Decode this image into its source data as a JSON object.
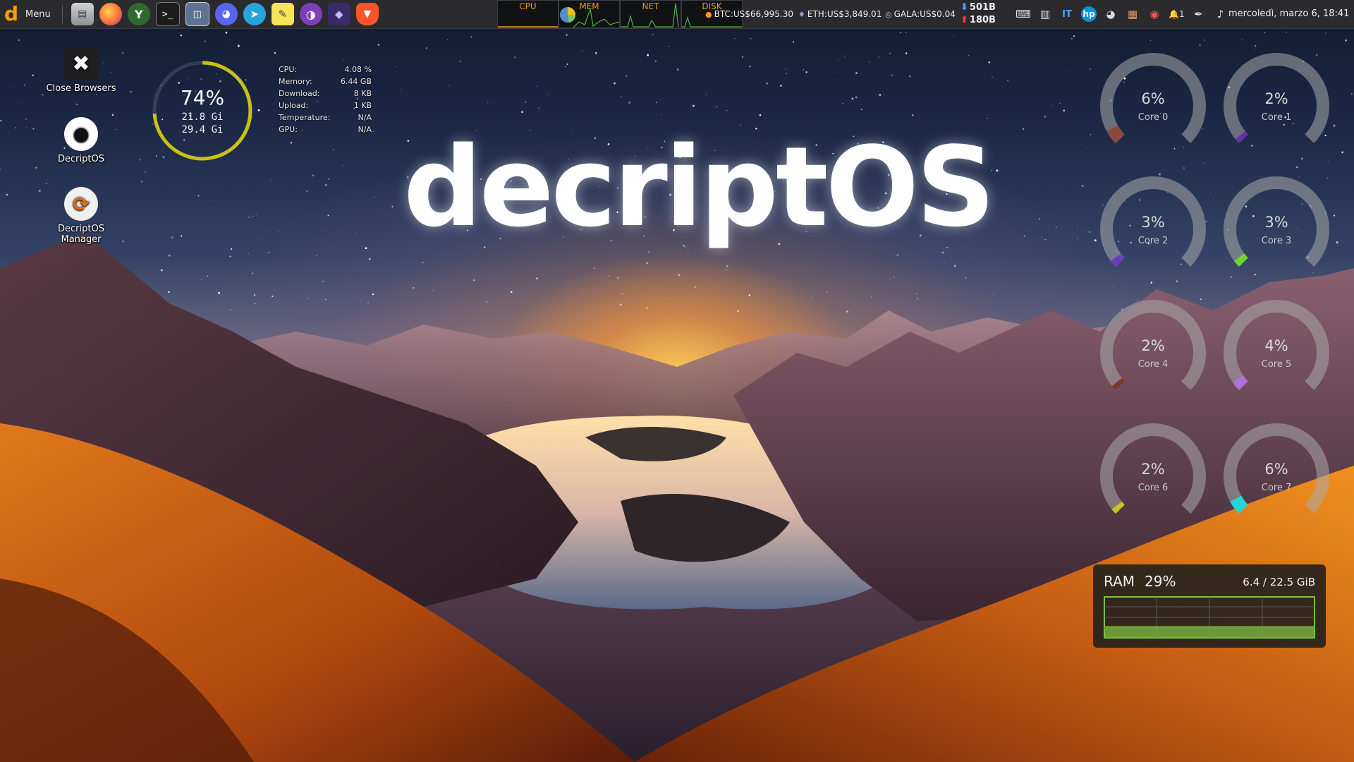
{
  "panel": {
    "menu_label": "Menu",
    "logo_letter": "d",
    "launchers": [
      {
        "name": "files-icon",
        "glyph": "▤"
      },
      {
        "name": "firefox-icon",
        "glyph": "●"
      },
      {
        "name": "vpn-icon",
        "glyph": "Y"
      },
      {
        "name": "terminal-icon",
        "glyph": ">_"
      },
      {
        "name": "screenshot-icon",
        "glyph": "◫"
      },
      {
        "name": "discord-icon",
        "glyph": "◕"
      },
      {
        "name": "telegram-icon",
        "glyph": "➤"
      },
      {
        "name": "notes-icon",
        "glyph": "✎"
      },
      {
        "name": "tor-icon",
        "glyph": "◑"
      },
      {
        "name": "proton-icon",
        "glyph": "◆"
      },
      {
        "name": "brave-icon",
        "glyph": "▼"
      }
    ],
    "monitors": {
      "cpu": "CPU",
      "mem": "MEM",
      "net": "NET",
      "disk": "DISK"
    },
    "crypto": {
      "btc": "BTC:US$66,995.30",
      "eth": "ETH:US$3,849.01",
      "gala": "GALA:US$0.04"
    },
    "net": {
      "down": "501B",
      "up": "180B"
    },
    "tray": {
      "lang": "IT",
      "hp": "hp",
      "notif_count": "1"
    },
    "clock": "mercoledì, marzo  6, 18:41"
  },
  "desktop_icons": [
    {
      "label": "Close Browsers",
      "glyph": "✖"
    },
    {
      "label": "DecriptOS",
      "glyph": "🐙"
    },
    {
      "label": "DecriptOS Manager",
      "glyph": "⟳"
    }
  ],
  "memory_widget": {
    "percent_text": "74%",
    "percent": 74,
    "used": "21.8 Gi",
    "total": "29.4 Gi",
    "ring_color": "#c9c11a"
  },
  "stats": [
    {
      "label": "CPU:",
      "value": "4.08 %"
    },
    {
      "label": "Memory:",
      "value": "6.44 GB"
    },
    {
      "label": "Download:",
      "value": "8 KB"
    },
    {
      "label": "Upload:",
      "value": "1 KB"
    },
    {
      "label": "Temperature:",
      "value": "N/A"
    },
    {
      "label": "GPU:",
      "value": "N/A"
    }
  ],
  "brand_text": "decriptOS",
  "cores": [
    {
      "label": "Core 0",
      "pct": "6%",
      "value": 6,
      "color": "#8a4a3a"
    },
    {
      "label": "Core 1",
      "pct": "2%",
      "value": 2,
      "color": "#6a2fa8"
    },
    {
      "label": "Core 2",
      "pct": "3%",
      "value": 3,
      "color": "#6a40b8"
    },
    {
      "label": "Core 3",
      "pct": "3%",
      "value": 3,
      "color": "#6ed62c"
    },
    {
      "label": "Core 4",
      "pct": "2%",
      "value": 2,
      "color": "#7a3a2a"
    },
    {
      "label": "Core 5",
      "pct": "4%",
      "value": 4,
      "color": "#b070e0"
    },
    {
      "label": "Core 6",
      "pct": "2%",
      "value": 2,
      "color": "#c8c816"
    },
    {
      "label": "Core 7",
      "pct": "6%",
      "value": 6,
      "color": "#22d6d6"
    }
  ],
  "ram_widget": {
    "title": "RAM",
    "percent_text": "29%",
    "percent": 29,
    "usage": "6.4 / 22.5 GiB",
    "color": "#7fbf3f"
  }
}
